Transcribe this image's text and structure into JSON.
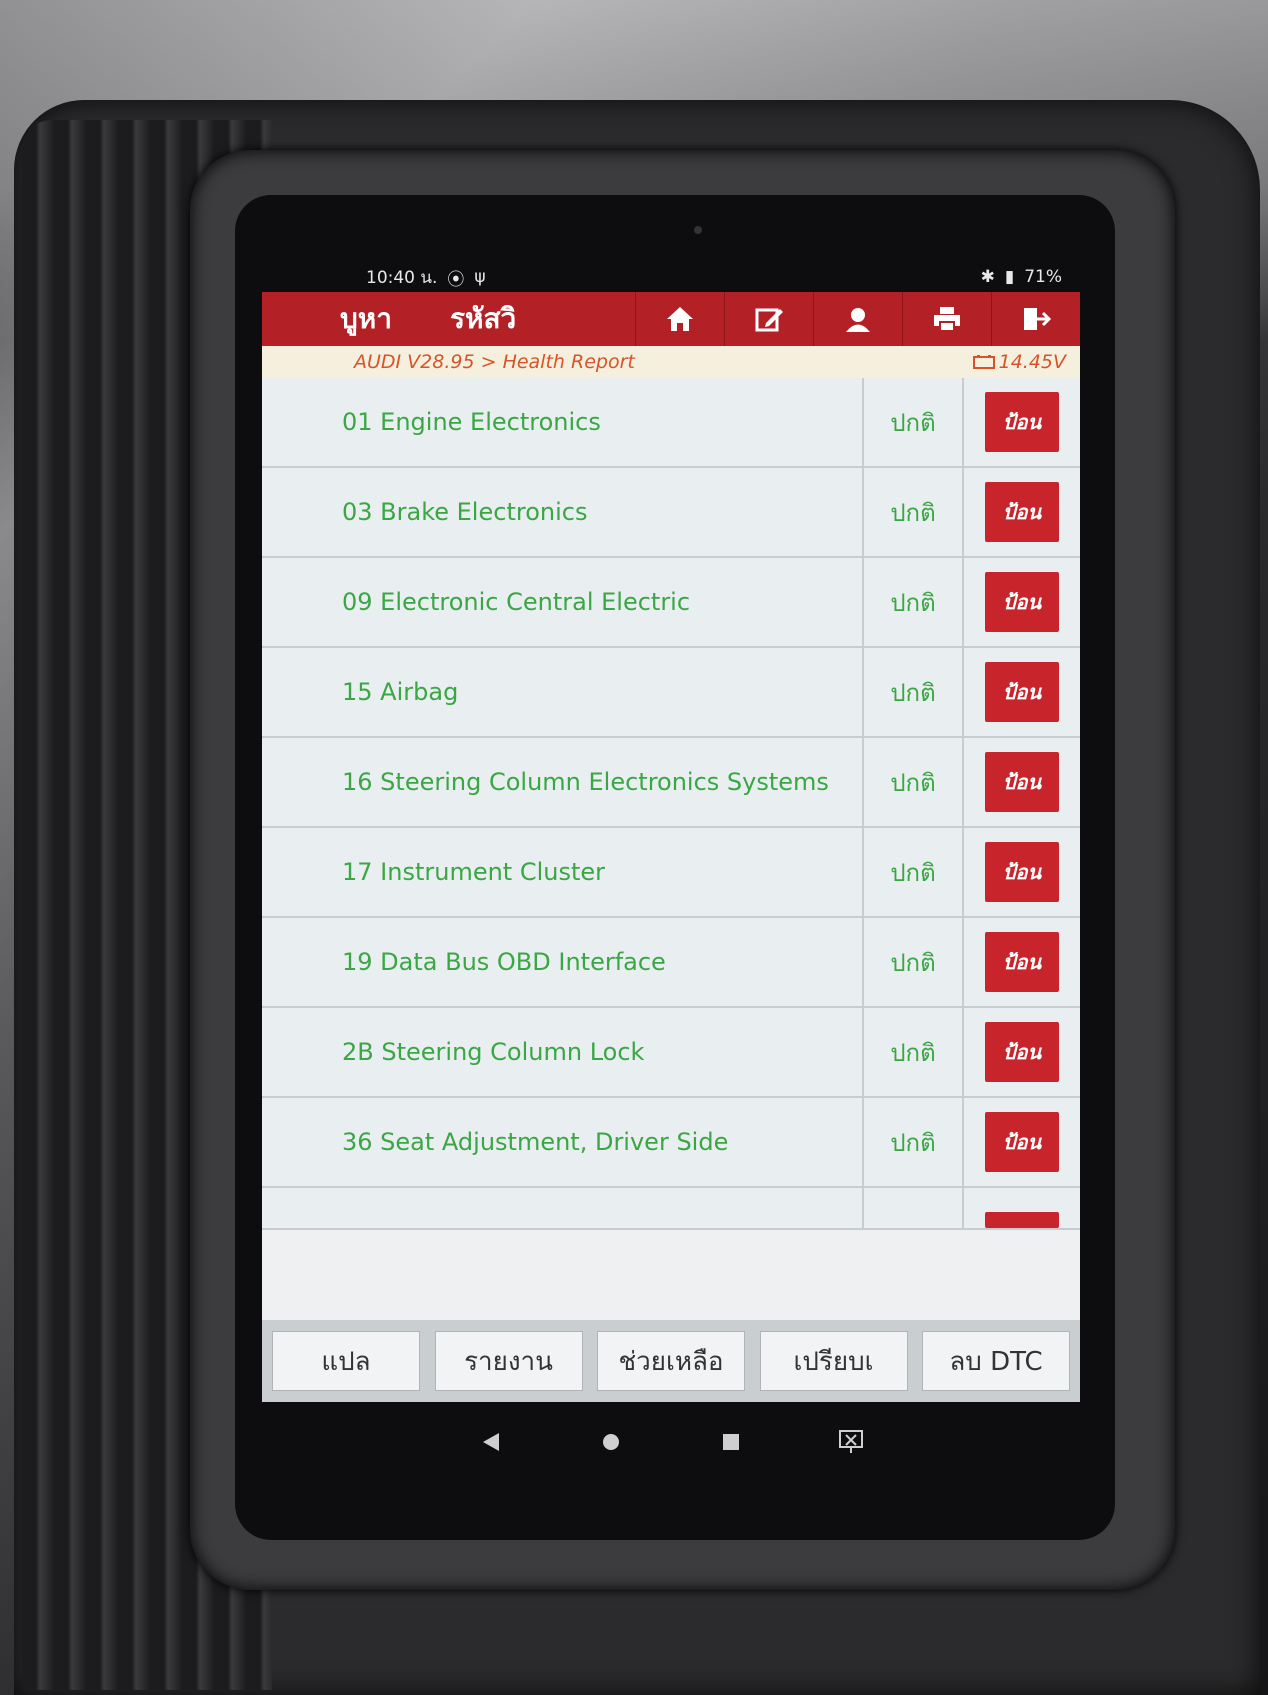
{
  "statusbar": {
    "time": "10:40 น.",
    "battery": "71%"
  },
  "toolbar": {
    "back_label": "บูหา",
    "code_label": "รหัสวิ"
  },
  "breadcrumb": {
    "path": "AUDI V28.95 > Health Report",
    "voltage": "14.45V"
  },
  "rows": [
    {
      "name": "01 Engine Electronics",
      "status": "ปกติ",
      "action": "ป้อน"
    },
    {
      "name": "03 Brake Electronics",
      "status": "ปกติ",
      "action": "ป้อน"
    },
    {
      "name": "09 Electronic Central Electric",
      "status": "ปกติ",
      "action": "ป้อน"
    },
    {
      "name": "15 Airbag",
      "status": "ปกติ",
      "action": "ป้อน"
    },
    {
      "name": "16 Steering Column Electronics Systems",
      "status": "ปกติ",
      "action": "ป้อน"
    },
    {
      "name": "17 Instrument Cluster",
      "status": "ปกติ",
      "action": "ป้อน"
    },
    {
      "name": "19 Data Bus OBD Interface",
      "status": "ปกติ",
      "action": "ป้อน"
    },
    {
      "name": "2B Steering Column Lock",
      "status": "ปกติ",
      "action": "ป้อน"
    },
    {
      "name": "36 Seat Adjustment, Driver Side",
      "status": "ปกติ",
      "action": "ป้อน"
    }
  ],
  "bottombar": {
    "translate": "แปล",
    "report": "รายงาน",
    "help": "ช่วยเหลือ",
    "compare": "เปรียบเ",
    "clear_dtc": "ลบ DTC"
  },
  "colors": {
    "accent": "#b32026",
    "ok_text": "#3aa744",
    "crumb_text": "#d8532a"
  }
}
